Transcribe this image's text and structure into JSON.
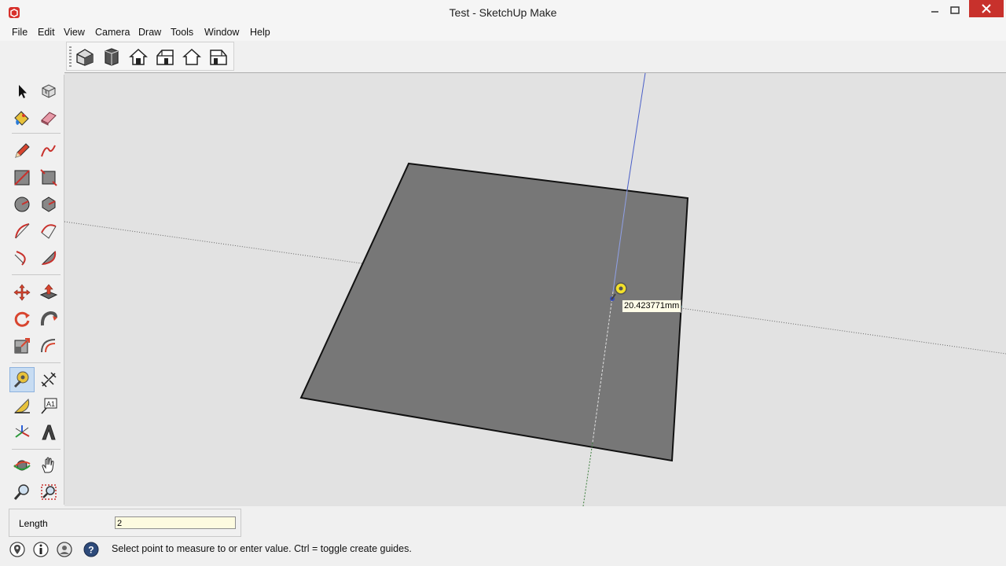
{
  "window": {
    "title": "Test - SketchUp Make"
  },
  "menu": [
    "File",
    "Edit",
    "View",
    "Camera",
    "Draw",
    "Tools",
    "Window",
    "Help"
  ],
  "views_toolbar": [
    "iso-view-icon",
    "top-view-icon",
    "front-view-icon",
    "right-view-icon",
    "back-view-icon",
    "left-view-icon"
  ],
  "tools": [
    [
      "select-arrow-icon",
      "make-component-icon"
    ],
    [
      "paint-bucket-icon",
      "eraser-icon"
    ],
    [
      "pencil-line-icon",
      "freehand-icon"
    ],
    [
      "rectangle-icon",
      "rotated-rectangle-icon"
    ],
    [
      "circle-icon",
      "polygon-icon"
    ],
    [
      "arc-icon",
      "two-point-arc-icon"
    ],
    [
      "three-point-arc-icon",
      "pie-icon"
    ],
    [
      "move-icon",
      "push-pull-icon"
    ],
    [
      "rotate-icon",
      "follow-me-icon"
    ],
    [
      "scale-icon",
      "offset-icon"
    ],
    [
      "tape-measure-icon",
      "dimension-icon"
    ],
    [
      "protractor-icon",
      "text-icon"
    ],
    [
      "axes-icon",
      "3d-text-icon"
    ],
    [
      "orbit-icon",
      "pan-icon"
    ],
    [
      "zoom-icon",
      "zoom-window-icon"
    ]
  ],
  "active_tool": "tape-measure-icon",
  "viewport": {
    "measurement_tooltip": "20.423771mm"
  },
  "vcb": {
    "label": "Length",
    "value": "2"
  },
  "status": {
    "text": "Select point to measure to or enter value.  Ctrl = toggle create guides.",
    "icons": [
      "geo-location-icon",
      "credits-icon",
      "user-account-icon",
      "help-icon"
    ]
  },
  "colors": {
    "face": "#777777",
    "canvas": "#e2e2e2",
    "active_tool_bg": "#c7dcf2",
    "close_button": "#c8312c",
    "tooltip_bg": "#fffde8"
  }
}
